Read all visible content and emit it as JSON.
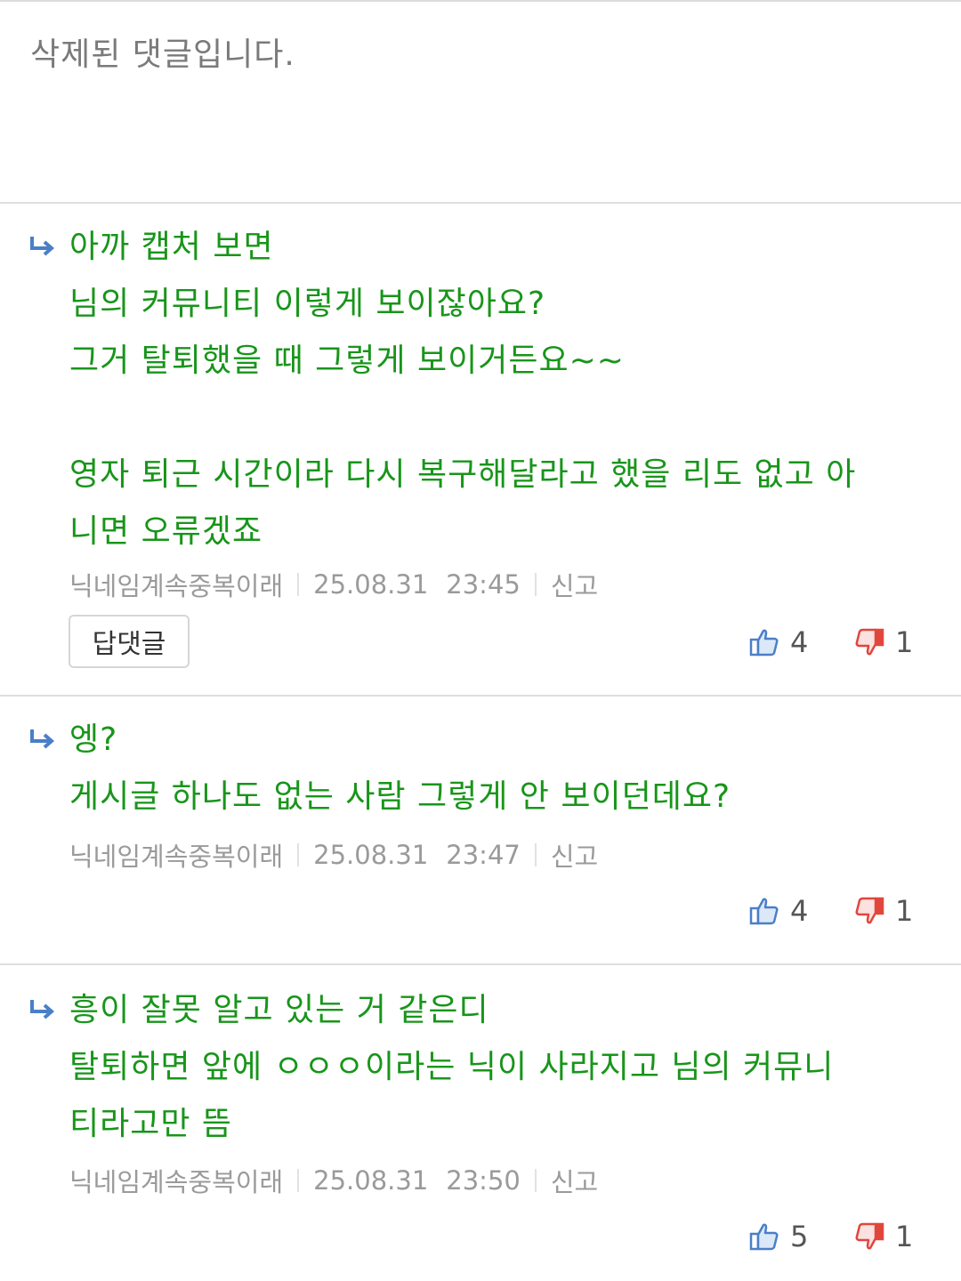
{
  "deleted_comment": {
    "text": "삭제된 댓글입니다."
  },
  "replies": [
    {
      "lines": [
        "아까 캡처 보면",
        "님의 커뮤니티 이렇게 보이잖아요?",
        "그거 탈퇴했을 때 그렇게 보이거든요~~",
        "",
        "영자 퇴근 시간이라 다시 복구해달라고 했을 리도 없고 아",
        "니면 오류겠죠"
      ],
      "author": "닉네임계속중복이래",
      "date": "25.08.31",
      "time": "23:45",
      "report_label": "신고",
      "reply_button_label": "답댓글",
      "likes": "4",
      "dislikes": "1"
    },
    {
      "lines": [
        "엥?",
        "게시글 하나도 없는 사람 그렇게 안 보이던데요?"
      ],
      "author": "닉네임계속중복이래",
      "date": "25.08.31",
      "time": "23:47",
      "report_label": "신고",
      "likes": "4",
      "dislikes": "1"
    },
    {
      "lines": [
        "흥이 잘못 알고 있는 거 같은디",
        "탈퇴하면 앞에 ㅇㅇㅇ이라는 닉이 사라지고 님의 커뮤니",
        "티라고만 뜸"
      ],
      "author": "닉네임계속중복이래",
      "date": "25.08.31",
      "time": "23:50",
      "report_label": "신고",
      "likes": "5",
      "dislikes": "1"
    }
  ],
  "colors": {
    "reply_text": "#18951a",
    "meta_text": "#9a9a9a",
    "like_icon": "#4a7fc8",
    "dislike_icon": "#e0463c"
  },
  "icons": {
    "reply_arrow": "reply-arrow-icon",
    "like": "thumbs-up-icon",
    "dislike": "thumbs-down-icon"
  }
}
